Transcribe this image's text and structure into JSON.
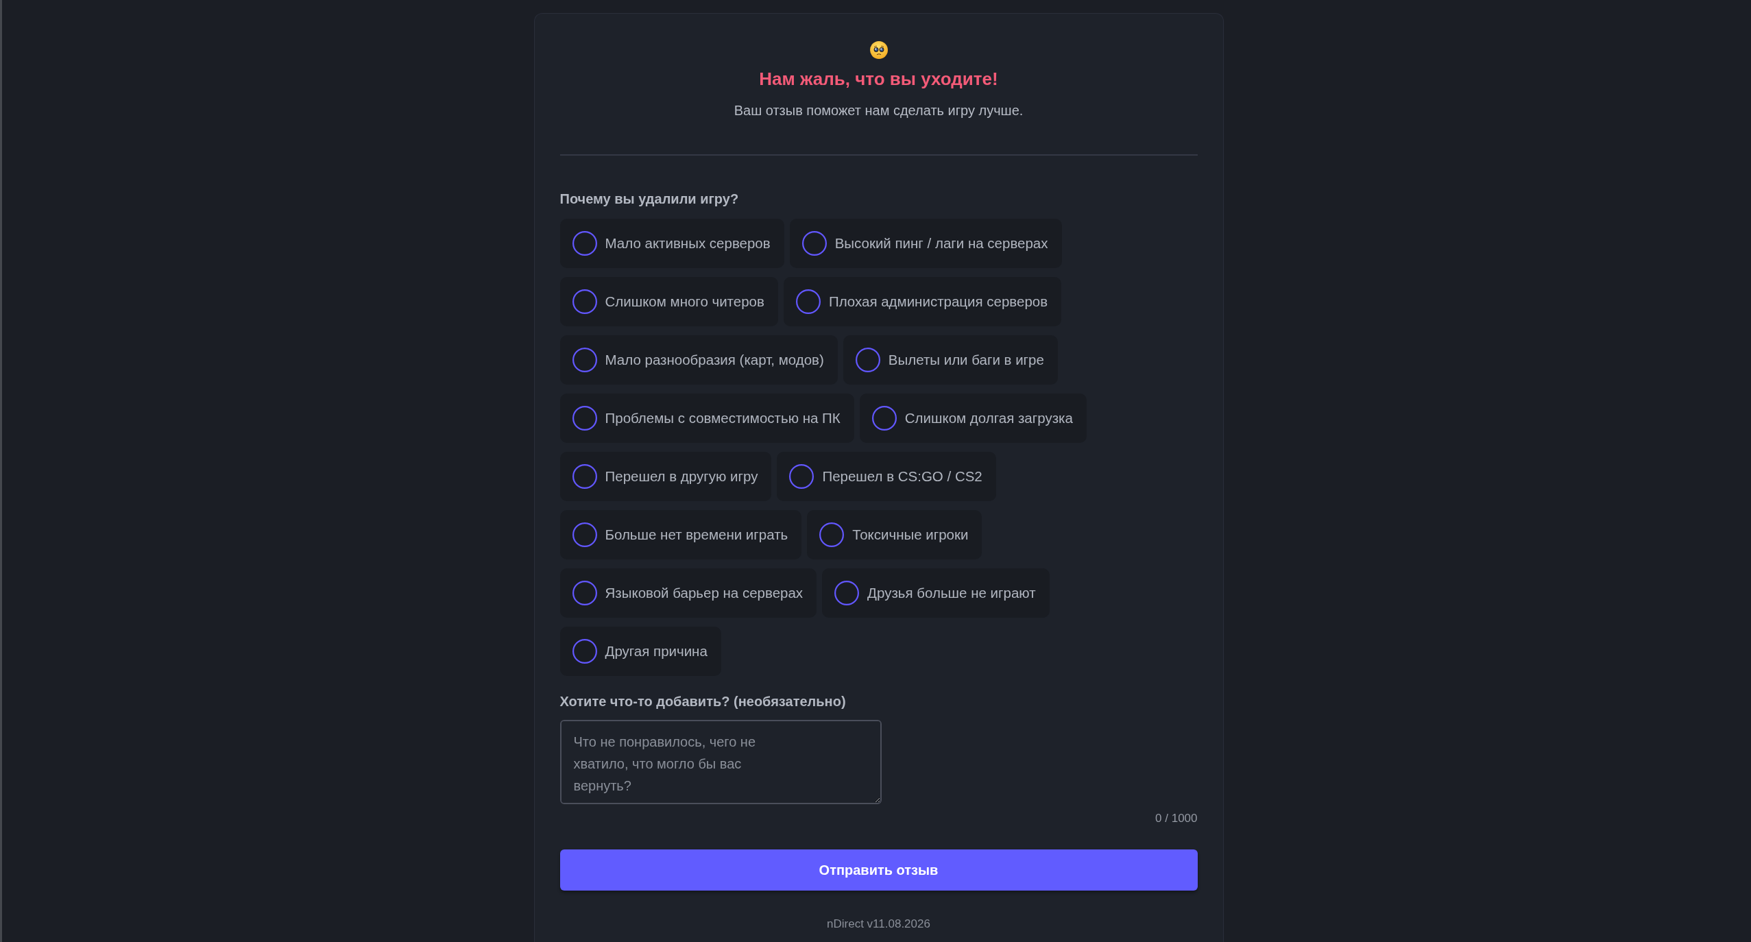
{
  "header": {
    "title": "Нам жаль, что вы уходите!",
    "subtitle": "Ваш отзыв поможет нам сделать игру лучше."
  },
  "reasons_question": "Почему вы удалили игру?",
  "reasons": [
    {
      "label": "Мало активных серверов",
      "selected": false
    },
    {
      "label": "Высокий пинг / лаги на серверах",
      "selected": false
    },
    {
      "label": "Слишком много читеров",
      "selected": false
    },
    {
      "label": "Плохая администрация серверов",
      "selected": false
    },
    {
      "label": "Мало разнообразия (карт, модов)",
      "selected": false
    },
    {
      "label": "Вылеты или баги в игре",
      "selected": false
    },
    {
      "label": "Проблемы с совместимостью на ПК",
      "selected": false
    },
    {
      "label": "Слишком долгая загрузка",
      "selected": false
    },
    {
      "label": "Перешел в другую игру",
      "selected": false
    },
    {
      "label": "Перешел в CS:GO / CS2",
      "selected": false
    },
    {
      "label": "Больше нет времени играть",
      "selected": false
    },
    {
      "label": "Токсичные игроки",
      "selected": false
    },
    {
      "label": "Языковой барьер на серверах",
      "selected": false
    },
    {
      "label": "Друзья больше не играют",
      "selected": false
    },
    {
      "label": "Другая причина",
      "selected": false
    }
  ],
  "comment": {
    "label": "Хотите что-то добавить? (необязательно)",
    "placeholder": "Что не понравилось, чего не хватило, что могло бы вас вернуть?",
    "counter": "0 / 1000"
  },
  "submit_button": "Отправить отзыв",
  "footer": "nDirect v11.08.2026"
}
